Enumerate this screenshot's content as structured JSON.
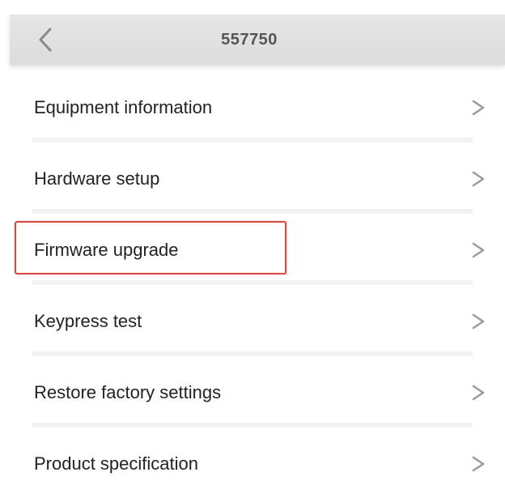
{
  "header": {
    "title": "557750",
    "back_icon": "chevron-left-icon"
  },
  "menu": {
    "items": [
      {
        "label": "Equipment information",
        "icon": "chevron-right-icon"
      },
      {
        "label": "Hardware setup",
        "icon": "chevron-right-icon"
      },
      {
        "label": "Firmware upgrade",
        "icon": "chevron-right-icon",
        "highlighted": true
      },
      {
        "label": "Keypress test",
        "icon": "chevron-right-icon"
      },
      {
        "label": "Restore factory settings",
        "icon": "chevron-right-icon"
      },
      {
        "label": "Product specification",
        "icon": "chevron-right-icon"
      }
    ]
  },
  "colors": {
    "header_bg": "#dcdcdc",
    "highlight_border": "#e0453f",
    "chevron": "#9a9a9a"
  }
}
